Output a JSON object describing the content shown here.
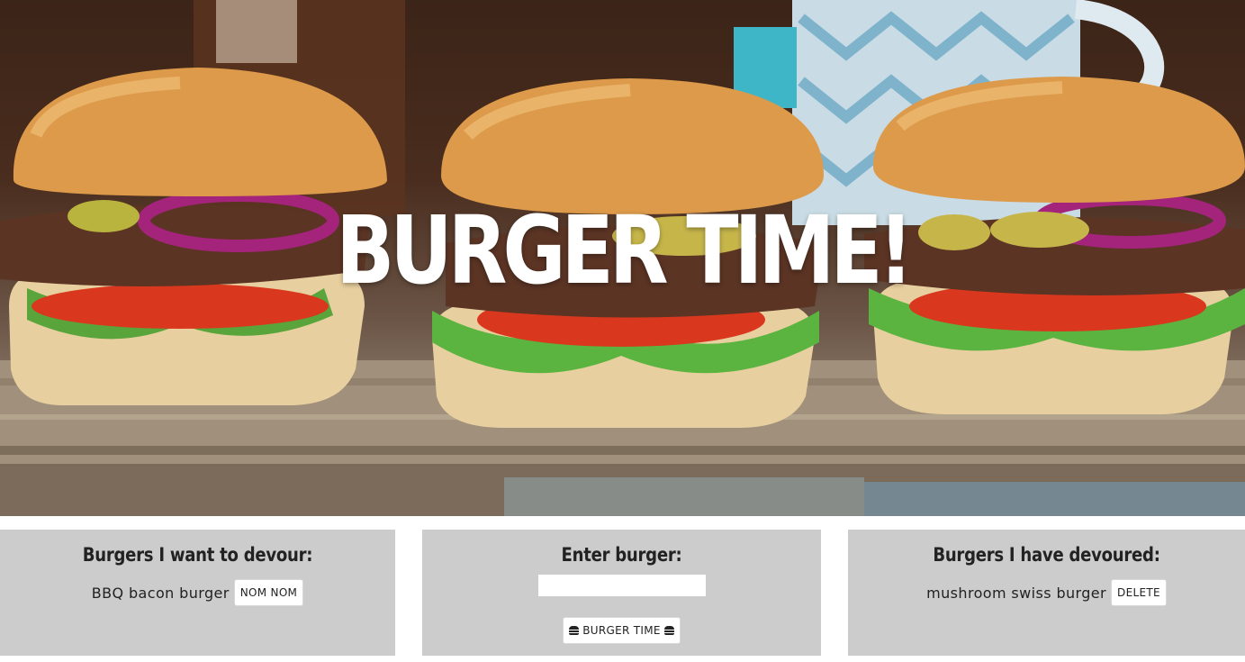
{
  "hero": {
    "title": "BURGER TIME!"
  },
  "panels": {
    "want": {
      "heading": "Burgers I want to devour:",
      "items": [
        {
          "name": "BBQ bacon burger",
          "action_label": "NOM NOM"
        }
      ]
    },
    "enter": {
      "heading": "Enter burger:",
      "input_value": "",
      "input_placeholder": "",
      "submit_label": "BURGER TIME",
      "submit_icon": "burger-icon"
    },
    "devoured": {
      "heading": "Burgers I have devoured:",
      "items": [
        {
          "name": "mushroom swiss burger",
          "action_label": "DELETE"
        }
      ]
    }
  },
  "colors": {
    "panel_background": "#cccccc",
    "heading_text": "#222222",
    "title_text": "#ffffff"
  }
}
